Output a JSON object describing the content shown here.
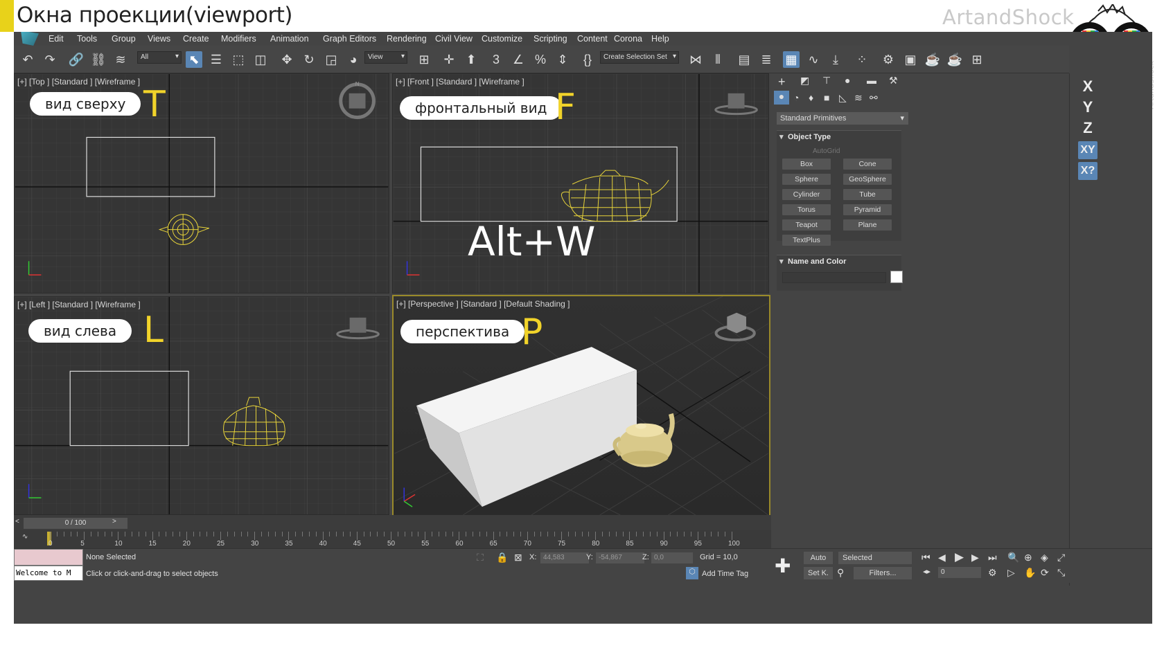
{
  "slide": {
    "title": "Окна проекции(viewport)",
    "brand": "ArtandShock",
    "brand_vertical": "ArtandShock"
  },
  "menu": [
    "Edit",
    "Tools",
    "Group",
    "Views",
    "Create",
    "Modifiers",
    "Animation",
    "Graph Editors",
    "Rendering",
    "Civil View",
    "Customize",
    "Scripting",
    "Content",
    "Corona",
    "Help"
  ],
  "toolbar": {
    "filter": "All",
    "ref_coord": "View",
    "selection_set": "Create Selection Set"
  },
  "viewports": {
    "top": {
      "label": "[+] [Top ] [Standard ] [Wireframe ]",
      "pill": "вид сверху",
      "letter": "T"
    },
    "front": {
      "label": "[+] [Front ] [Standard ] [Wireframe ]",
      "pill": "фронтальный вид",
      "letter": "F",
      "hotkey": "Alt+W"
    },
    "left": {
      "label": "[+] [Left ] [Standard ] [Wireframe ]",
      "pill": "вид слева",
      "letter": "L"
    },
    "persp": {
      "label": "[+] [Perspective ] [Standard ] [Default Shading ]",
      "pill": "перспектива",
      "letter": "P"
    }
  },
  "command_panel": {
    "category": "Standard Primitives",
    "object_type": "Object Type",
    "autogrid": "AutoGrid",
    "primitives": [
      "Box",
      "Cone",
      "Sphere",
      "GeoSphere",
      "Cylinder",
      "Tube",
      "Torus",
      "Pyramid",
      "Teapot",
      "Plane",
      "TextPlus"
    ],
    "name_color": "Name and Color"
  },
  "axis_constraints": [
    "X",
    "Y",
    "Z",
    "XY",
    "X?"
  ],
  "timeline": {
    "frame": "0 / 100",
    "ticks": [
      "5",
      "10",
      "15",
      "20",
      "25",
      "30",
      "35",
      "40",
      "45",
      "50",
      "55",
      "60",
      "65",
      "70",
      "75",
      "80",
      "85",
      "90",
      "95",
      "100"
    ],
    "zero": "0"
  },
  "status": {
    "listener": "Welcome to M",
    "selection": "None Selected",
    "prompt": "Click or click-and-drag to select objects",
    "x_label": "X:",
    "x_val": "44,583",
    "y_label": "Y:",
    "y_val": "-54,867",
    "z_label": "Z:",
    "z_val": "0,0",
    "grid": "Grid = 10,0",
    "time_tag": "Add Time Tag",
    "auto": "Auto",
    "setk": "Set K.",
    "selected": "Selected",
    "filters": "Filters...",
    "frame_field": "0"
  }
}
